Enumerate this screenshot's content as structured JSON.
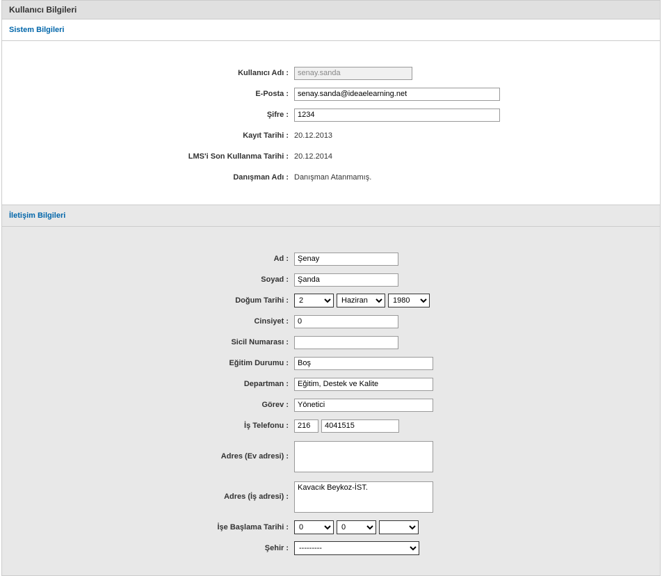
{
  "pageTitle": "Kullanıcı Bilgileri",
  "sections": {
    "system": {
      "title": "Sistem Bilgileri",
      "fields": {
        "usernameLabel": "Kullanıcı Adı :",
        "usernameValue": "senay.sanda",
        "emailLabel": "E-Posta :",
        "emailValue": "senay.sanda@ideaelearning.net",
        "passwordLabel": "Şifre :",
        "passwordValue": "1234",
        "regDateLabel": "Kayıt Tarihi :",
        "regDateValue": "20.12.2013",
        "lmsExpiryLabel": "LMS'i Son Kullanma Tarihi :",
        "lmsExpiryValue": "20.12.2014",
        "advisorLabel": "Danışman Adı :",
        "advisorValue": "Danışman Atanmamış."
      }
    },
    "contact": {
      "title": "İletişim Bilgileri",
      "fields": {
        "firstNameLabel": "Ad :",
        "firstNameValue": "Şenay",
        "lastNameLabel": "Soyad :",
        "lastNameValue": "Şanda",
        "birthDateLabel": "Doğum Tarihi :",
        "birthDay": "2",
        "birthMonth": "Haziran",
        "birthYear": "1980",
        "genderLabel": "Cinsiyet :",
        "genderValue": "0",
        "employeeNoLabel": "Sicil Numarası :",
        "employeeNoValue": "",
        "educationLabel": "Eğitim Durumu :",
        "educationValue": "Boş",
        "departmentLabel": "Departman :",
        "departmentValue": "Eğitim, Destek ve Kalite",
        "roleLabel": "Görev :",
        "roleValue": "Yönetici",
        "workPhoneLabel": "İş Telefonu :",
        "workPhoneAreaValue": "216",
        "workPhoneNumberValue": "4041515",
        "homeAddressLabel": "Adres (Ev adresi) :",
        "homeAddressValue": "",
        "workAddressLabel": "Adres (İş adresi) :",
        "workAddressValue": "Kavacık Beykoz-İST.",
        "startDateLabel": "İşe Başlama Tarihi :",
        "startDay": "0",
        "startMonth": "0",
        "startYear": "",
        "cityLabel": "Şehir :",
        "cityValue": "---------"
      }
    }
  }
}
